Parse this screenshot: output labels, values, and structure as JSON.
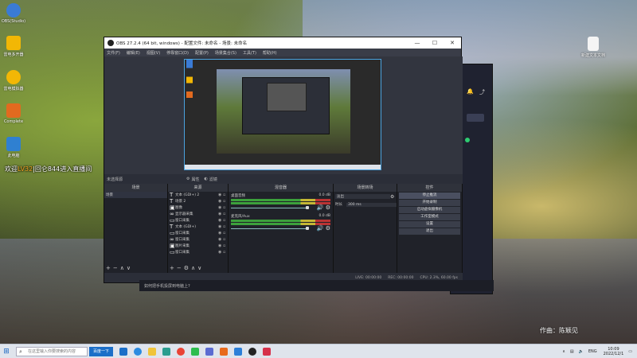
{
  "desktop": {
    "icons": [
      {
        "label": "OBS(Studio)",
        "color": "#3a7bd5"
      },
      {
        "label": "雷电多开器",
        "color": "#f2b705"
      },
      {
        "label": "雷电模拟器",
        "color": "#f2b705"
      },
      {
        "label": "Complete",
        "color": "#e26a1f"
      },
      {
        "label": "此电脑",
        "color": "#2f80d1"
      }
    ],
    "right_icon": {
      "label": "新建文本文档"
    }
  },
  "obs": {
    "title": "OBS 27.2.4 (64 bit, windows) - 配置文件: 未命名 - 场景: 未命名",
    "menu": [
      "文件(F)",
      "编辑(E)",
      "视图(V)",
      "停靠窗口(D)",
      "配置(P)",
      "场景集合(S)",
      "工具(T)",
      "帮助(H)"
    ],
    "panel_row": "未选择源",
    "panel_props": "属性",
    "panel_filters": "滤镜",
    "docks": {
      "scenes": {
        "title": "场景",
        "items": [
          "场景"
        ]
      },
      "sources": {
        "title": "来源",
        "items": [
          {
            "name": "文本 (GDI+) 2"
          },
          {
            "name": "场景 2"
          },
          {
            "name": "图像"
          },
          {
            "name": "显示器采集"
          },
          {
            "name": "窗口采集"
          },
          {
            "name": "文本 (GDI+)"
          },
          {
            "name": "窗口采集"
          },
          {
            "name": "窗口采集"
          },
          {
            "name": "图片采集"
          },
          {
            "name": "窗口采集"
          }
        ]
      },
      "mixer": {
        "title": "混音器",
        "channels": [
          {
            "name": "桌面音频",
            "db": "0.0 dB"
          },
          {
            "name": "麦克风/Aux",
            "db": "0.0 dB"
          }
        ]
      },
      "transitions": {
        "title": "场景转场",
        "mode": "淡出",
        "duration_label": "时长",
        "duration": "300 ms"
      },
      "controls": {
        "title": "控件",
        "buttons": [
          "停止推流",
          "开始录制",
          "启动虚拟摄像机",
          "工作室模式",
          "设置",
          "退出"
        ]
      }
    },
    "status": {
      "live": "LIVE: 00:00:00",
      "rec": "REC: 00:00:00",
      "cpu": "CPU: 2.3%, 60.00 fps"
    }
  },
  "overlay": {
    "chat_prefix": "欢迎",
    "chat_highlight": "LV32",
    "chat_suffix": "|回仑844进入直播间",
    "author": "作曲：陈颖见"
  },
  "lower_bar": {
    "notice": "如何把手机投屏到电脑上?"
  },
  "taskbar": {
    "search_placeholder": "在这里输入你要搜索的内容",
    "app_button": "百度一下",
    "tray_lang": "ENG",
    "time": "10:09",
    "date": "2022/12/1"
  },
  "colors": {
    "accent": "#1b6fc8",
    "obs_bg": "#2b2e38",
    "selection": "#4aa3df"
  }
}
